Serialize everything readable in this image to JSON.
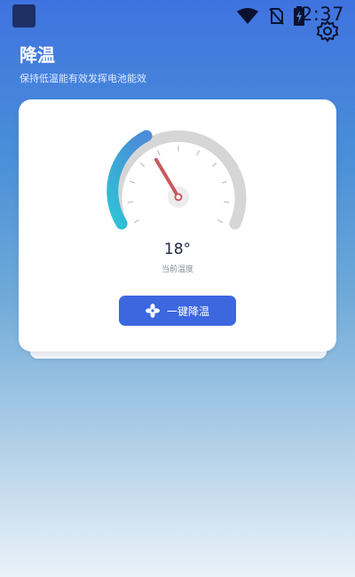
{
  "status_bar": {
    "time": "2:37"
  },
  "header": {
    "title": "降温",
    "subtitle": "保持低温能有效发挥电池能效"
  },
  "gauge": {
    "temperature": "18°",
    "label": "当前温度"
  },
  "action": {
    "button_label": "一键降温"
  },
  "colors": {
    "accent": "#3d67de",
    "arc_active_start": "#2ec4d6",
    "arc_active_end": "#4a8fd8",
    "arc_track": "#d6d6d6",
    "needle": "#c9585e"
  },
  "icons": [
    "wifi-icon",
    "no-sim-icon",
    "battery-charging-icon",
    "settings-icon",
    "fan-icon"
  ]
}
